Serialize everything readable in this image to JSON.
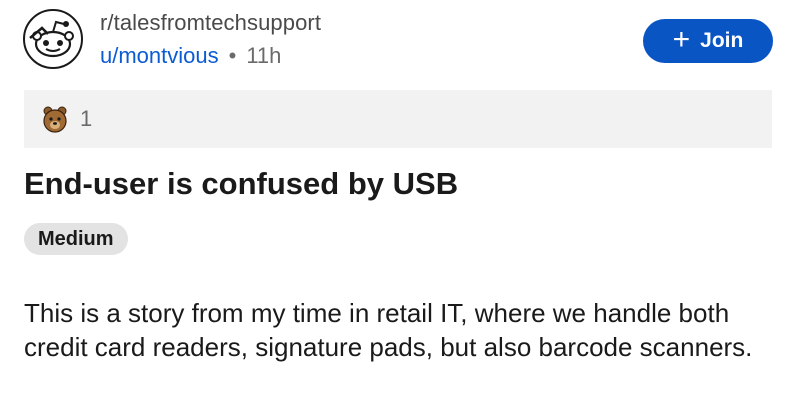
{
  "post_header": {
    "avatar_icon": "reddit-snoo-avatar-icon",
    "subreddit": "r/talesfromtechsupport",
    "username": "u/montvious",
    "separator": "•",
    "time_ago": "11h",
    "join_button": {
      "icon": "plus-icon",
      "icon_glyph": "+",
      "label": "Join",
      "color": "#0a55c4"
    }
  },
  "awards": {
    "icon": "bear-award-icon",
    "count": "1"
  },
  "post": {
    "title": "End-user is confused by USB",
    "flair": "Medium",
    "body": "This is a story from my time in retail IT, where we handle both credit card readers, signature pads, but also barcode scanners."
  }
}
